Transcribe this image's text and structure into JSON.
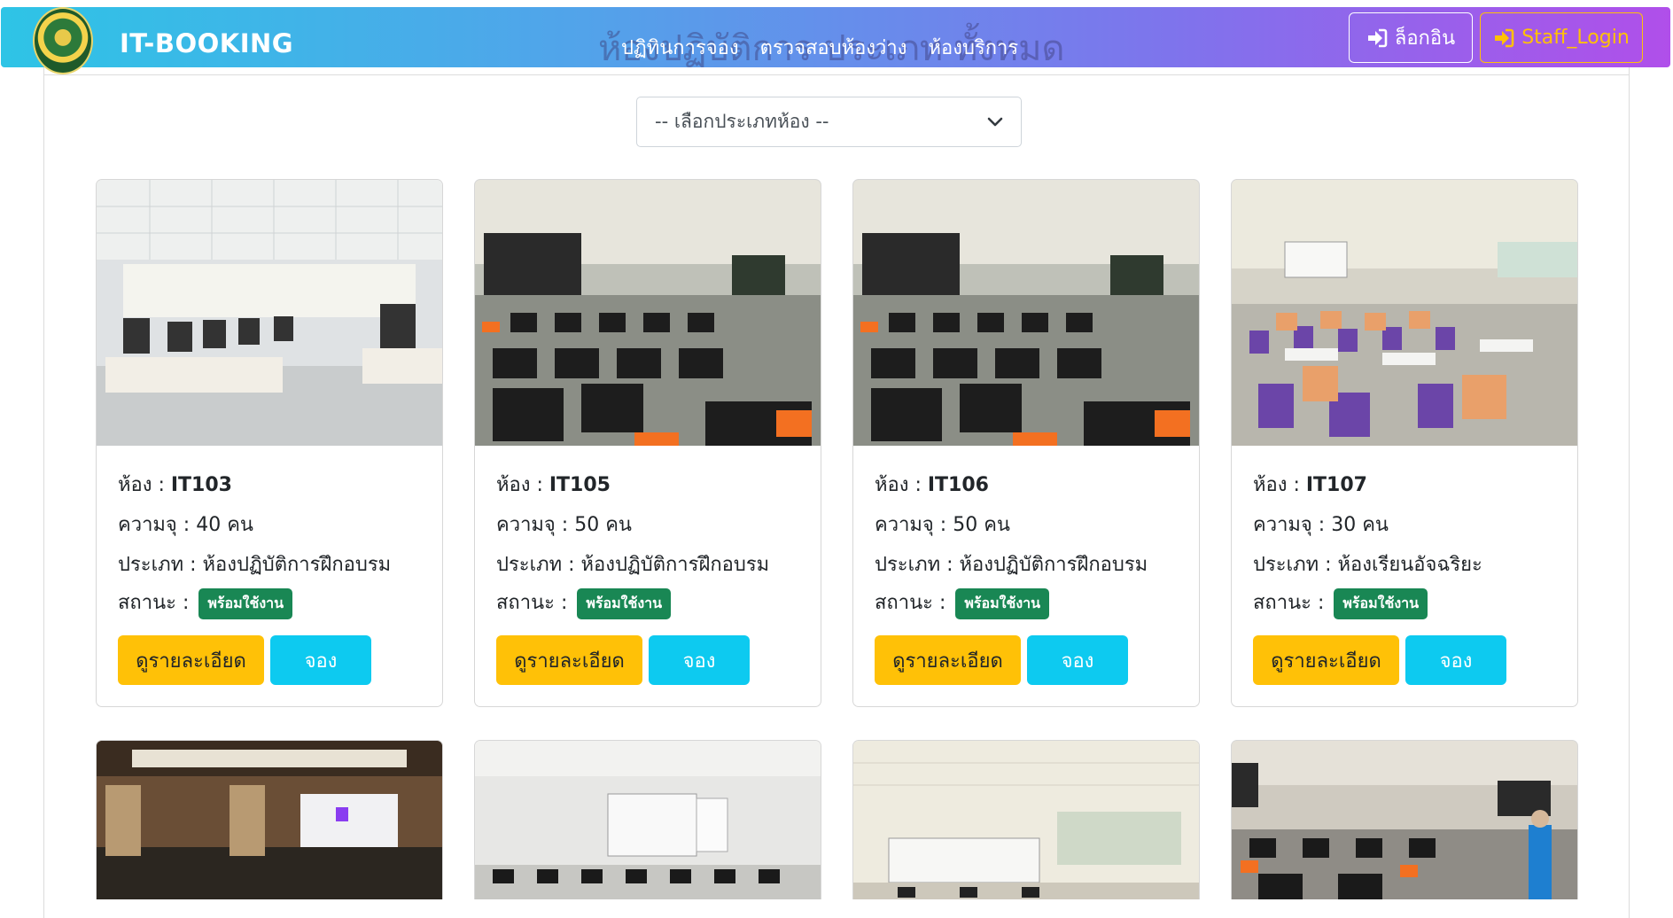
{
  "navbar": {
    "brand": "IT-BOOKING",
    "background_title": "ห้องปฏิบัติการ ประเภท ทั้งหมด",
    "links": [
      "ปฏิทินการจอง",
      "ตรวจสอบห้องว่าง",
      "ห้องบริการ"
    ],
    "login_label": "ล็อกอิน",
    "staff_login_label": "Staff_Login",
    "login_icon": "sign-in-icon"
  },
  "filter": {
    "placeholder": "-- เลือกประเภทห้อง --",
    "icon": "chevron-down-icon"
  },
  "labels": {
    "room": "ห้อง : ",
    "capacity": "ความจุ : ",
    "type": "ประเภท : ",
    "status": "สถานะ : ",
    "detail_button": "ดูรายละเอียด",
    "book_button": "จอง"
  },
  "rooms": [
    {
      "room": "IT103",
      "capacity": "40 คน",
      "type": "ห้องปฏิบัติการฝึกอบรม",
      "status": "พร้อมใช้งาน"
    },
    {
      "room": "IT105",
      "capacity": "50 คน",
      "type": "ห้องปฏิบัติการฝึกอบรม",
      "status": "พร้อมใช้งาน"
    },
    {
      "room": "IT106",
      "capacity": "50 คน",
      "type": "ห้องปฏิบัติการฝึกอบรม",
      "status": "พร้อมใช้งาน"
    },
    {
      "room": "IT107",
      "capacity": "30 คน",
      "type": "ห้องเรียนอัจฉริยะ",
      "status": "พร้อมใช้งาน"
    }
  ],
  "colors": {
    "status_badge": "#198754",
    "detail_button": "#ffc107",
    "book_button": "#0dcaf0",
    "staff_login": "#ffc107"
  }
}
